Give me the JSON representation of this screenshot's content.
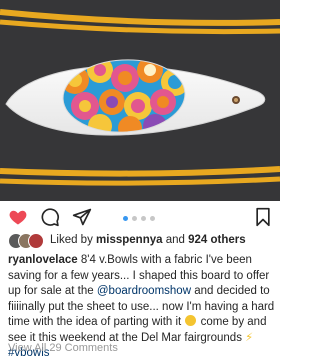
{
  "post": {
    "liked_by_prefix": "Liked by ",
    "liked_by_user": "misspennya",
    "liked_and": " and ",
    "others_count": "924 others",
    "caption_user": "ryanlovelace",
    "caption_part1": " 8'4 v.Bowls with a fabric I've been saving for a few years... I shaped this board to offer up for sale at the ",
    "caption_mention": "@boardroomshow",
    "caption_part2": " and decided to fiiiinally put the sheet to use... now I'm having a hard time with the idea of parting with it ",
    "caption_part3": " come by and see it this weekend at the Del Mar fairgrounds ",
    "caption_hashtag": "#vbowls",
    "view_comments": "View All 29 Comments"
  },
  "icons": {
    "like": "heart-icon",
    "comment": "comment-icon",
    "share": "send-icon",
    "save": "bookmark-icon"
  },
  "carousel": {
    "count": 4,
    "active": 1
  },
  "colors": {
    "accent_dot": "#3897f0",
    "link": "#003569",
    "muted": "#999999"
  }
}
